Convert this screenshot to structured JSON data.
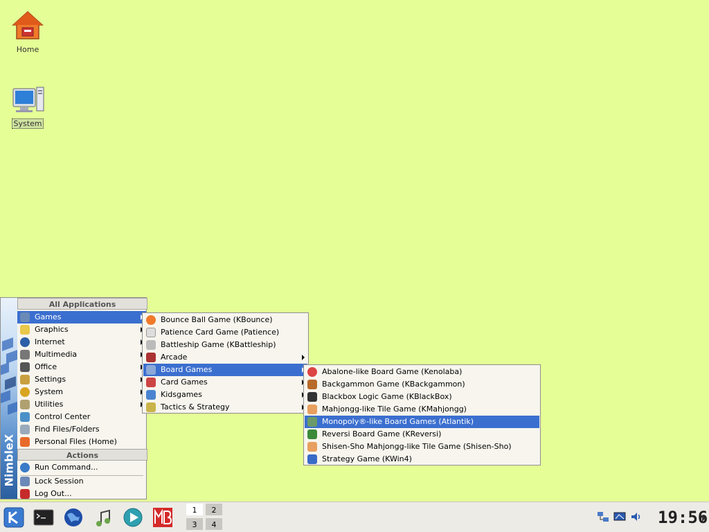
{
  "desktop": {
    "icons": [
      {
        "label": "Home"
      },
      {
        "label": "System"
      }
    ]
  },
  "kmenu": {
    "brand": "NimbleX",
    "header_all": "All Applications",
    "header_actions": "Actions",
    "categories": [
      {
        "label": "Games",
        "icon": "joystick-icon"
      },
      {
        "label": "Graphics",
        "icon": "paint-icon"
      },
      {
        "label": "Internet",
        "icon": "globe-icon"
      },
      {
        "label": "Multimedia",
        "icon": "media-icon"
      },
      {
        "label": "Office",
        "icon": "office-icon"
      },
      {
        "label": "Settings",
        "icon": "wrench-icon"
      },
      {
        "label": "System",
        "icon": "gear-icon"
      },
      {
        "label": "Utilities",
        "icon": "utilities-icon"
      }
    ],
    "links": [
      {
        "label": "Control Center",
        "icon": "control-center-icon"
      },
      {
        "label": "Find Files/Folders",
        "icon": "find-icon"
      },
      {
        "label": "Personal Files (Home)",
        "icon": "home-icon"
      }
    ],
    "actions": [
      {
        "label": "Run Command...",
        "icon": "run-icon"
      },
      {
        "label": "Lock Session",
        "icon": "lock-icon"
      },
      {
        "label": "Log Out...",
        "icon": "logout-icon"
      }
    ]
  },
  "games_menu": {
    "items": [
      {
        "label": "Bounce Ball Game (KBounce)"
      },
      {
        "label": "Patience Card Game (Patience)"
      },
      {
        "label": "Battleship Game (KBattleship)"
      },
      {
        "label": "Arcade"
      },
      {
        "label": "Board Games"
      },
      {
        "label": "Card Games"
      },
      {
        "label": "Kidsgames"
      },
      {
        "label": "Tactics & Strategy"
      }
    ]
  },
  "board_games_menu": {
    "items": [
      {
        "label": "Abalone-like Board Game (Kenolaba)"
      },
      {
        "label": "Backgammon Game (KBackgammon)"
      },
      {
        "label": "Blackbox Logic Game (KBlackBox)"
      },
      {
        "label": "Mahjongg-like Tile Game (KMahjongg)"
      },
      {
        "label": "Monopoly®-like Board Games (Atlantik)"
      },
      {
        "label": "Reversi Board Game (KReversi)"
      },
      {
        "label": "Shisen-Sho Mahjongg-like Tile Game (Shisen-Sho)"
      },
      {
        "label": "Strategy Game (KWin4)"
      }
    ]
  },
  "taskbar": {
    "pager": [
      "1",
      "2",
      "3",
      "4"
    ],
    "clock": "19:56"
  }
}
